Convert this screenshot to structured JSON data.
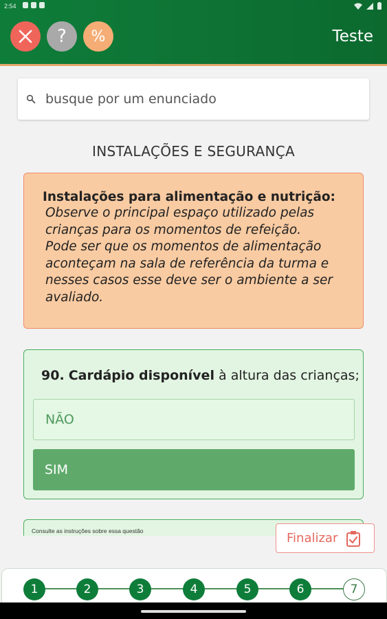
{
  "status_bar": {
    "time": "2:54",
    "icons": [
      "gear-icon",
      "sim-icon",
      "box-icon",
      "wifi-icon",
      "signal-icon",
      "battery-icon"
    ]
  },
  "header": {
    "title": "Teste",
    "close_icon": "close-icon",
    "help_label": "?",
    "percent_label": "%",
    "colors": {
      "green": "#0f7d3a",
      "close": "#f0655a",
      "help": "#a9a9a9",
      "percent": "#f5ad75",
      "underline": "#e2a66b"
    }
  },
  "search": {
    "placeholder": "busque por um enunciado",
    "value": ""
  },
  "section_title": "INSTALAÇÕES E SEGURANÇA",
  "info_card": {
    "title": "Instalações para alimentação e nutrição:",
    "body": [
      "Observe o principal espaço utilizado pelas",
      "crianças para os momentos de refeição.",
      "Pode ser que os momentos de alimentação",
      "aconteçam na sala de referência da turma e",
      "nesses casos esse deve ser o ambiente a ser",
      "avaliado."
    ]
  },
  "question": {
    "number": "90.",
    "bold": "Cardápio disponível",
    "rest": "à altura das crianças;",
    "options": [
      {
        "label": "NÃO",
        "selected": false
      },
      {
        "label": "SIM",
        "selected": true
      }
    ]
  },
  "instructions": {
    "text": "Consulte as instruções sobre essa questão"
  },
  "finalize": {
    "label": "Finalizar",
    "icon": "clipboard-check-icon"
  },
  "pager": {
    "steps": [
      "1",
      "2",
      "3",
      "4",
      "5",
      "6",
      "7"
    ],
    "current": "7"
  }
}
